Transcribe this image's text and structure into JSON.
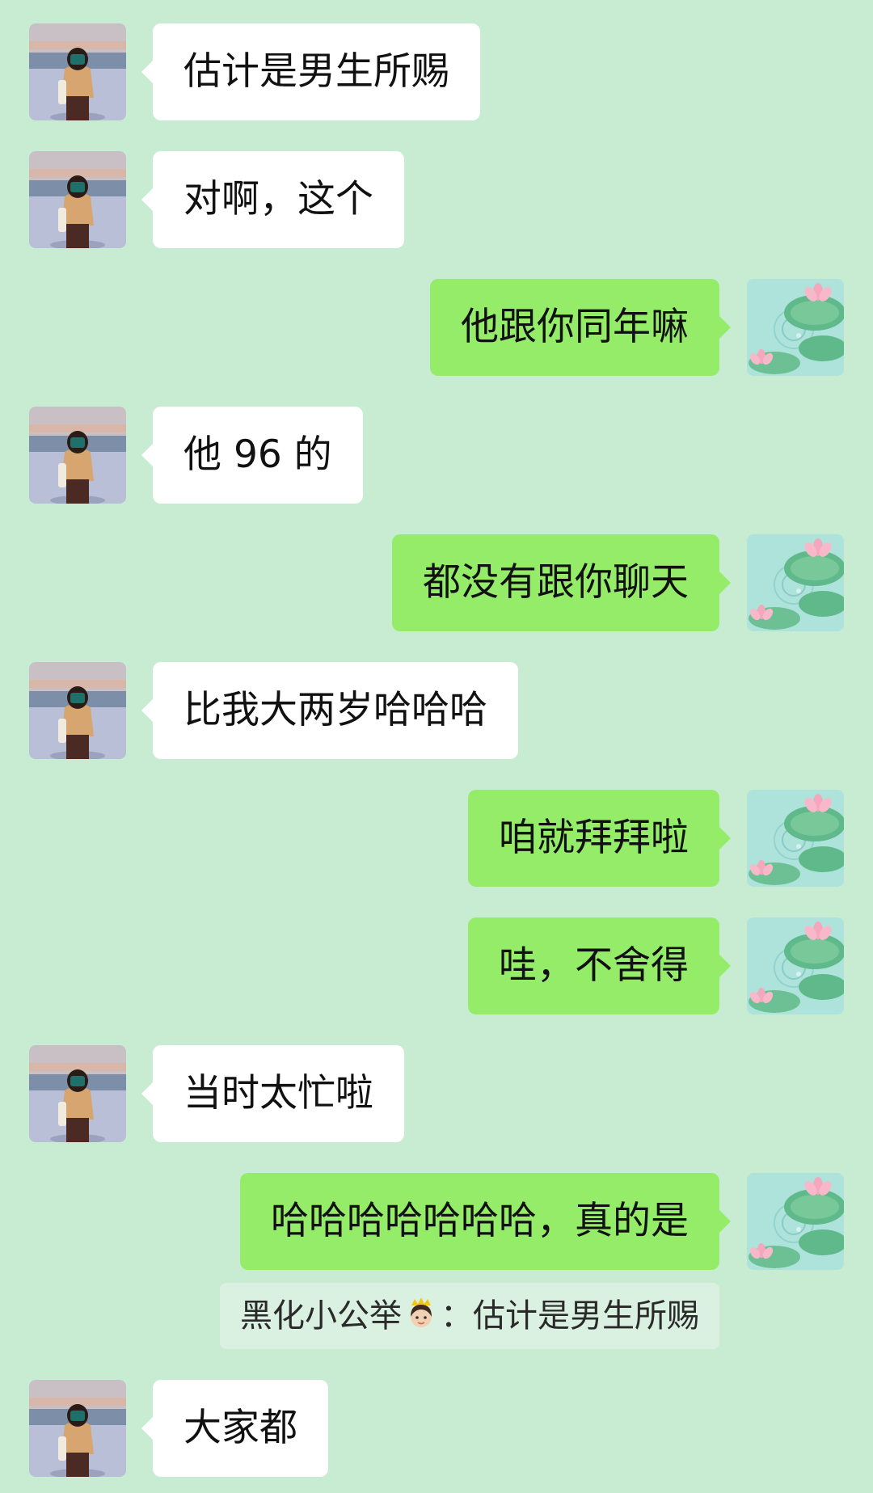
{
  "chat": {
    "colors": {
      "background": "#c8ecd2",
      "incoming_bubble": "#ffffff",
      "outgoing_bubble": "#95ec69",
      "quote_bg": "#daf0e0"
    },
    "messages": [
      {
        "side": "incoming",
        "text": "估计是男生所赐",
        "avatar": "girl-photo-avatar"
      },
      {
        "side": "incoming",
        "text": "对啊，这个",
        "avatar": "girl-photo-avatar"
      },
      {
        "side": "outgoing",
        "text": "他跟你同年嘛",
        "avatar": "lotus-pond-avatar"
      },
      {
        "side": "incoming",
        "text": "他 96 的",
        "avatar": "girl-photo-avatar"
      },
      {
        "side": "outgoing",
        "text": "都没有跟你聊天",
        "avatar": "lotus-pond-avatar"
      },
      {
        "side": "incoming",
        "text": "比我大两岁哈哈哈",
        "avatar": "girl-photo-avatar"
      },
      {
        "side": "outgoing",
        "text": "咱就拜拜啦",
        "avatar": "lotus-pond-avatar"
      },
      {
        "side": "outgoing",
        "text": "哇，不舍得",
        "avatar": "lotus-pond-avatar"
      },
      {
        "side": "incoming",
        "text": "当时太忙啦",
        "avatar": "girl-photo-avatar"
      },
      {
        "side": "outgoing",
        "text": "哈哈哈哈哈哈哈，真的是",
        "avatar": "lotus-pond-avatar"
      },
      {
        "side": "incoming",
        "text": "大家都",
        "avatar": "girl-photo-avatar"
      }
    ],
    "quote": {
      "sender": "黑化小公举",
      "emoji": "princess-emoji-icon",
      "separator": "：",
      "text": "估计是男生所赐"
    }
  }
}
